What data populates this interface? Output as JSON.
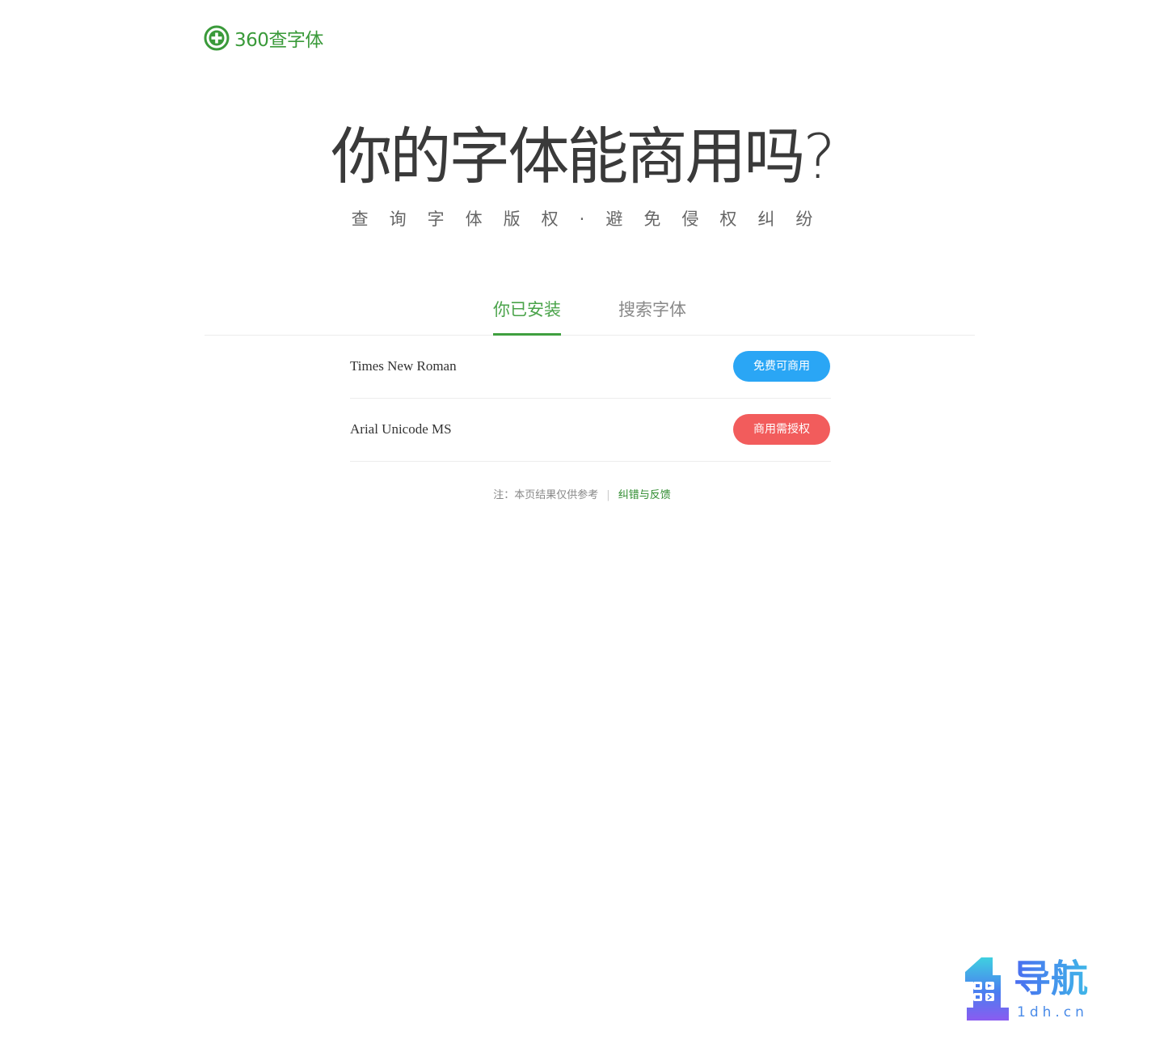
{
  "header": {
    "logo_text": "360查字体",
    "logo_icon": "plus-circle-icon"
  },
  "hero": {
    "title": "你的字体能商用吗?",
    "subtitle": "查询字体版权·避免侵权纠纷"
  },
  "tabs": [
    {
      "label": "你已安装",
      "active": true
    },
    {
      "label": "搜索字体",
      "active": false
    }
  ],
  "fonts": [
    {
      "name": "Times New Roman",
      "status": "免费可商用",
      "status_color": "#2aa6f5"
    },
    {
      "name": "Arial Unicode MS",
      "status": "商用需授权",
      "status_color": "#f25c5c"
    }
  ],
  "note": {
    "text": "注：本页结果仅供参考",
    "separator": "|",
    "link": "纠错与反馈"
  },
  "watermark": {
    "title": "导航",
    "subtitle": "1dh.cn"
  },
  "colors": {
    "brand_green": "#3f9f3f",
    "free_blue": "#2aa6f5",
    "license_red": "#f25c5c"
  }
}
